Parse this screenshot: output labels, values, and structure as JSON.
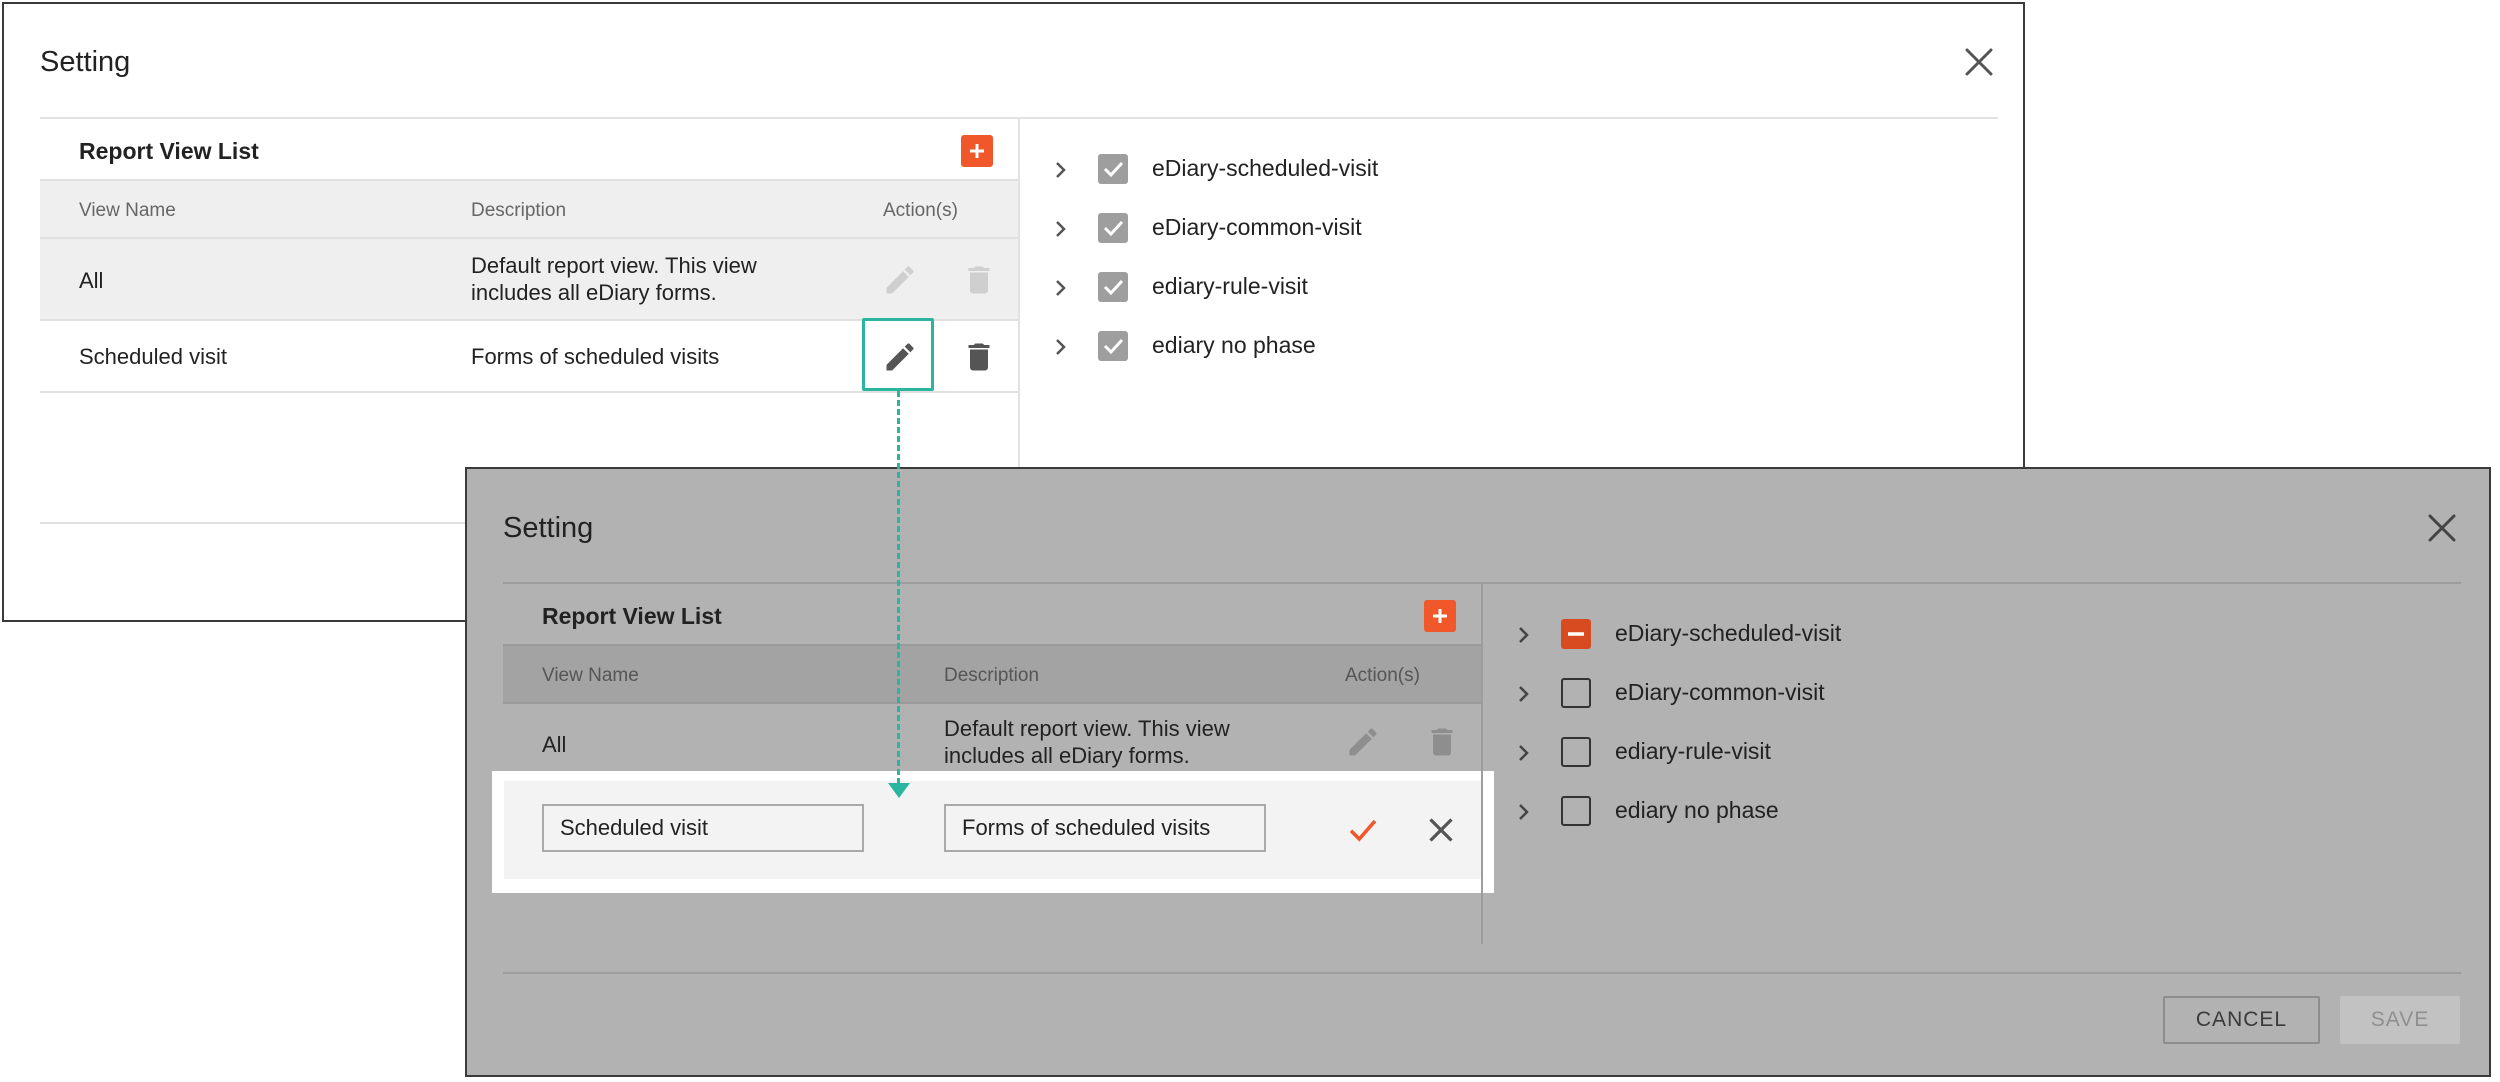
{
  "dialog_back": {
    "title": "Setting",
    "panel_title": "Report View List",
    "columns": {
      "view_name": "View Name",
      "description": "Description",
      "actions": "Action(s)"
    },
    "rows": [
      {
        "view_name": "All",
        "description": "Default report view. This view includes all eDiary forms."
      },
      {
        "view_name": "Scheduled visit",
        "description": "Forms of scheduled visits"
      }
    ],
    "tree": [
      {
        "label": "eDiary-scheduled-visit",
        "state": "checked"
      },
      {
        "label": "eDiary-common-visit",
        "state": "checked"
      },
      {
        "label": "ediary-rule-visit",
        "state": "checked"
      },
      {
        "label": "ediary no phase",
        "state": "checked"
      }
    ]
  },
  "dialog_front": {
    "title": "Setting",
    "panel_title": "Report View List",
    "columns": {
      "view_name": "View Name",
      "description": "Description",
      "actions": "Action(s)"
    },
    "rows": [
      {
        "view_name": "All",
        "description": "Default report view. This view includes all eDiary forms."
      }
    ],
    "edit_row": {
      "view_name_value": "Scheduled visit",
      "description_value": "Forms of scheduled visits"
    },
    "tree": [
      {
        "label": "eDiary-scheduled-visit",
        "state": "indeterminate"
      },
      {
        "label": "eDiary-common-visit",
        "state": "unchecked"
      },
      {
        "label": "ediary-rule-visit",
        "state": "unchecked"
      },
      {
        "label": "ediary no phase",
        "state": "unchecked"
      }
    ],
    "cancel_label": "CANCEL",
    "save_label": "SAVE"
  },
  "colors": {
    "accent_orange": "#f0572a",
    "annotation_teal": "#2bb5a0",
    "checkbox_grey": "#9e9e9e"
  },
  "icons": [
    "close-icon",
    "add-icon",
    "pencil-icon",
    "trash-icon",
    "chevron-right-icon",
    "checkbox-checked-icon",
    "checkbox-indeterminate-icon",
    "checkbox-unchecked-icon",
    "checkmark-icon"
  ]
}
